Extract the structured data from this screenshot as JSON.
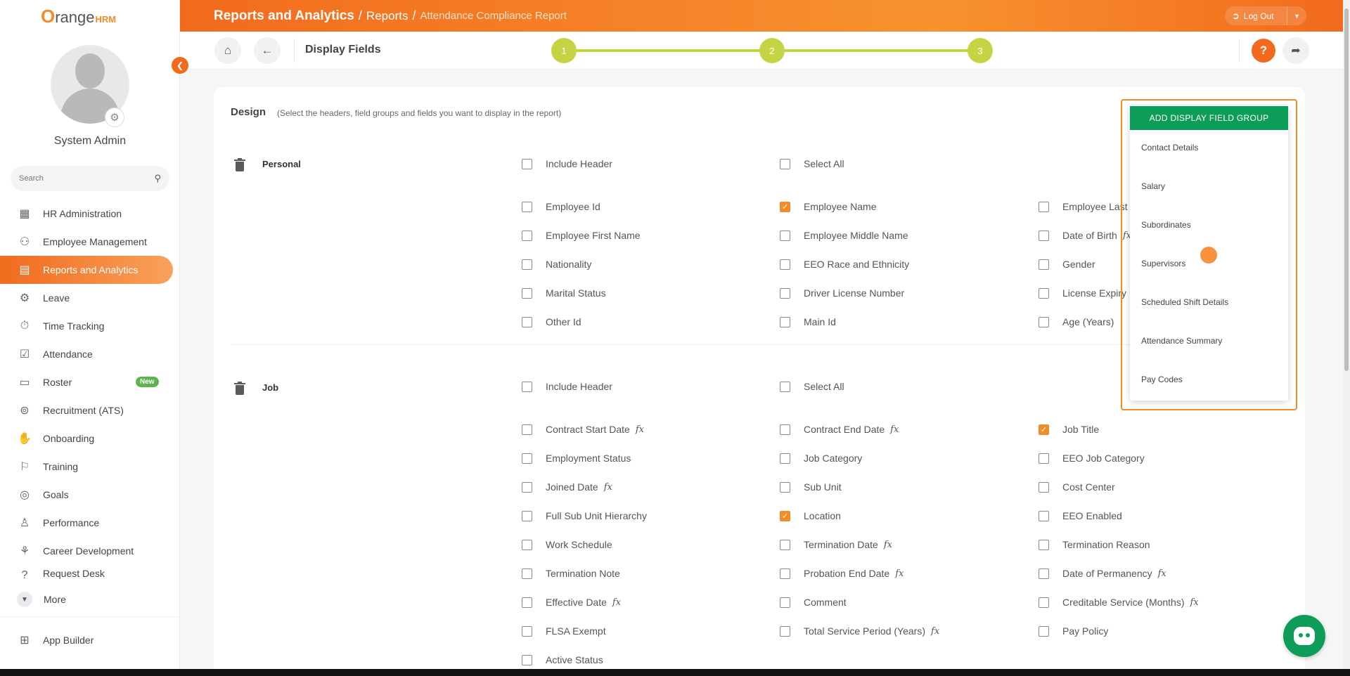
{
  "brand": {
    "logo_o": "O",
    "logo_range": "range",
    "logo_hrm": "HRM"
  },
  "user": {
    "name": "System Admin"
  },
  "sidebar": {
    "search_placeholder": "Search",
    "items": [
      {
        "label": "HR Administration",
        "icon": "hr-admin-icon",
        "glyph": "▦"
      },
      {
        "label": "Employee Management",
        "icon": "employees-icon",
        "glyph": "⚇"
      },
      {
        "label": "Reports and Analytics",
        "icon": "reports-icon",
        "glyph": "▤"
      },
      {
        "label": "Leave",
        "icon": "leave-icon",
        "glyph": "⚙"
      },
      {
        "label": "Time Tracking",
        "icon": "time-icon",
        "glyph": "⏱"
      },
      {
        "label": "Attendance",
        "icon": "attendance-icon",
        "glyph": "☑"
      },
      {
        "label": "Roster",
        "icon": "roster-icon",
        "glyph": "▭"
      },
      {
        "label": "Recruitment (ATS)",
        "icon": "recruitment-icon",
        "glyph": "⊚"
      },
      {
        "label": "Onboarding",
        "icon": "onboarding-icon",
        "glyph": "✋"
      },
      {
        "label": "Training",
        "icon": "training-icon",
        "glyph": "⚐"
      },
      {
        "label": "Goals",
        "icon": "goals-icon",
        "glyph": "◎"
      },
      {
        "label": "Performance",
        "icon": "performance-icon",
        "glyph": "♙"
      },
      {
        "label": "Career Development",
        "icon": "career-icon",
        "glyph": "⚘"
      },
      {
        "label": "Request Desk",
        "icon": "request-icon",
        "glyph": "?"
      }
    ],
    "badge_new": "New",
    "more": "More",
    "app_builder": "App Builder"
  },
  "topbar": {
    "crumb1": "Reports and Analytics",
    "crumb2": "Reports",
    "crumb3": "Attendance Compliance Report",
    "sep": "/",
    "logout": "Log Out"
  },
  "subheader": {
    "title": "Display Fields",
    "steps": [
      "1",
      "2",
      "3"
    ]
  },
  "design": {
    "title": "Design",
    "subtitle": "(Select the headers, field groups and fields you want to display in the report)"
  },
  "sections": {
    "personal": {
      "title": "Personal",
      "include_header": "Include Header",
      "select_all": "Select All",
      "col1": [
        "Employee Id",
        "Employee First Name",
        "Nationality",
        "Marital Status",
        "Other Id"
      ],
      "col2": [
        "Employee Name",
        "Employee Middle Name",
        "EEO Race and Ethnicity",
        "Driver License Number",
        "Main Id"
      ],
      "col3": [
        "Employee Last",
        "Date of Birth",
        "Gender",
        "License Expiry I",
        "Age (Years)"
      ]
    },
    "job": {
      "title": "Job",
      "include_header": "Include Header",
      "select_all": "Select All",
      "col1": [
        "Contract Start Date",
        "Employment Status",
        "Joined Date",
        "Full Sub Unit Hierarchy",
        "Work Schedule",
        "Termination Note",
        "Effective Date",
        "FLSA Exempt",
        "Active Status"
      ],
      "col2": [
        "Contract End Date",
        "Job Category",
        "Sub Unit",
        "Location",
        "Termination Date",
        "Probation End Date",
        "Comment",
        "Total Service Period (Years)"
      ],
      "col3": [
        "Job Title",
        "EEO Job Category",
        "Cost Center",
        "EEO Enabled",
        "Termination Reason",
        "Date of Permanency",
        "Creditable Service (Months)",
        "Pay Policy"
      ]
    }
  },
  "dropdown": {
    "add_label": "ADD DISPLAY FIELD GROUP",
    "options": [
      "Contact Details",
      "Salary",
      "Subordinates",
      "Supervisors",
      "Scheduled Shift Details",
      "Attendance Summary",
      "Pay Codes"
    ]
  },
  "fx_symbol": "fx",
  "check_mark": "✓",
  "colors": {
    "accent": "#f26b1d",
    "green": "#0e9d58",
    "step": "#c4d444"
  }
}
